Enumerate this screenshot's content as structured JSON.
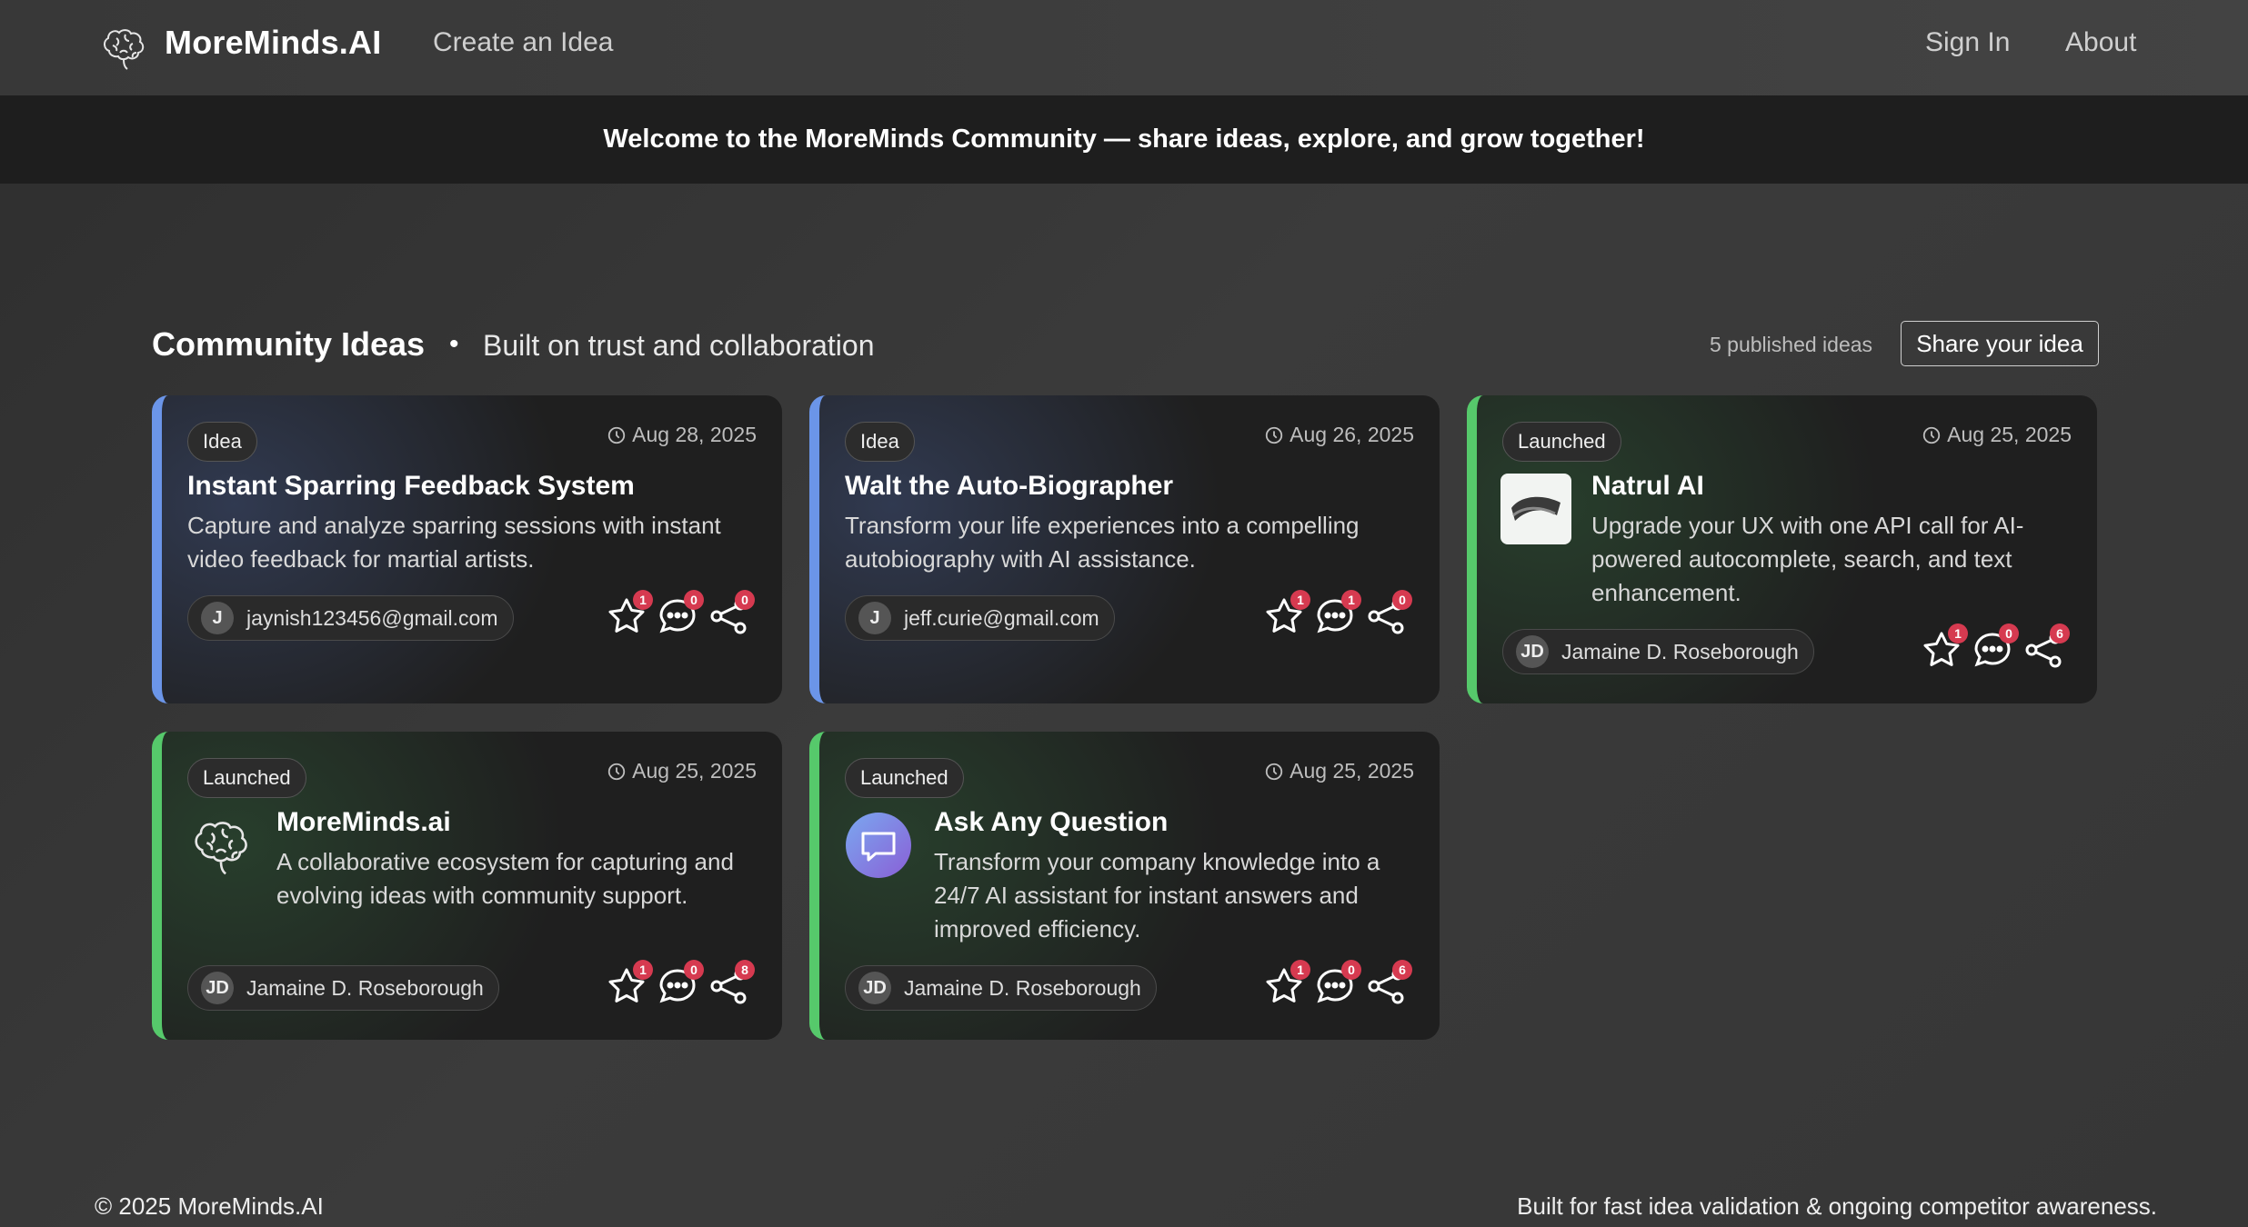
{
  "nav": {
    "brand": "MoreMinds.AI",
    "create_link": "Create an Idea",
    "sign_in": "Sign In",
    "about": "About"
  },
  "banner": "Welcome to the MoreMinds Community — share ideas, explore, and grow together!",
  "section": {
    "title": "Community Ideas",
    "dot": "•",
    "subtitle": "Built on trust and collaboration",
    "count": "5 published ideas",
    "share_button": "Share your idea"
  },
  "cards": [
    {
      "status": "Idea",
      "date": "Aug 28, 2025",
      "title": "Instant Sparring Feedback System",
      "description": "Capture and analyze sparring sessions with instant video feedback for martial artists.",
      "author_initials": "J",
      "author": "jaynish123456@gmail.com",
      "stars": "1",
      "comments": "0",
      "shares": "0"
    },
    {
      "status": "Idea",
      "date": "Aug 26, 2025",
      "title": "Walt the Auto-Biographer",
      "description": "Transform your life experiences into a compelling autobiography with AI assistance.",
      "author_initials": "J",
      "author": "jeff.curie@gmail.com",
      "stars": "1",
      "comments": "1",
      "shares": "0"
    },
    {
      "status": "Launched",
      "date": "Aug 25, 2025",
      "title": "Natrul AI",
      "description": "Upgrade your UX with one API call for AI-powered autocomplete, search, and text enhancement.",
      "author_initials": "JD",
      "author": "Jamaine D. Roseborough",
      "stars": "1",
      "comments": "0",
      "shares": "6"
    },
    {
      "status": "Launched",
      "date": "Aug 25, 2025",
      "title": "MoreMinds.ai",
      "description": "A collaborative ecosystem for capturing and evolving ideas with community support.",
      "author_initials": "JD",
      "author": "Jamaine D. Roseborough",
      "stars": "1",
      "comments": "0",
      "shares": "8"
    },
    {
      "status": "Launched",
      "date": "Aug 25, 2025",
      "title": "Ask Any Question",
      "description": "Transform your company knowledge into a 24/7 AI assistant for instant answers and improved efficiency.",
      "author_initials": "JD",
      "author": "Jamaine D. Roseborough",
      "stars": "1",
      "comments": "0",
      "shares": "6"
    }
  ],
  "footer": {
    "copyright": "© 2025 MoreMinds.AI",
    "tagline": "Built for fast idea validation & ongoing competitor awareness."
  }
}
